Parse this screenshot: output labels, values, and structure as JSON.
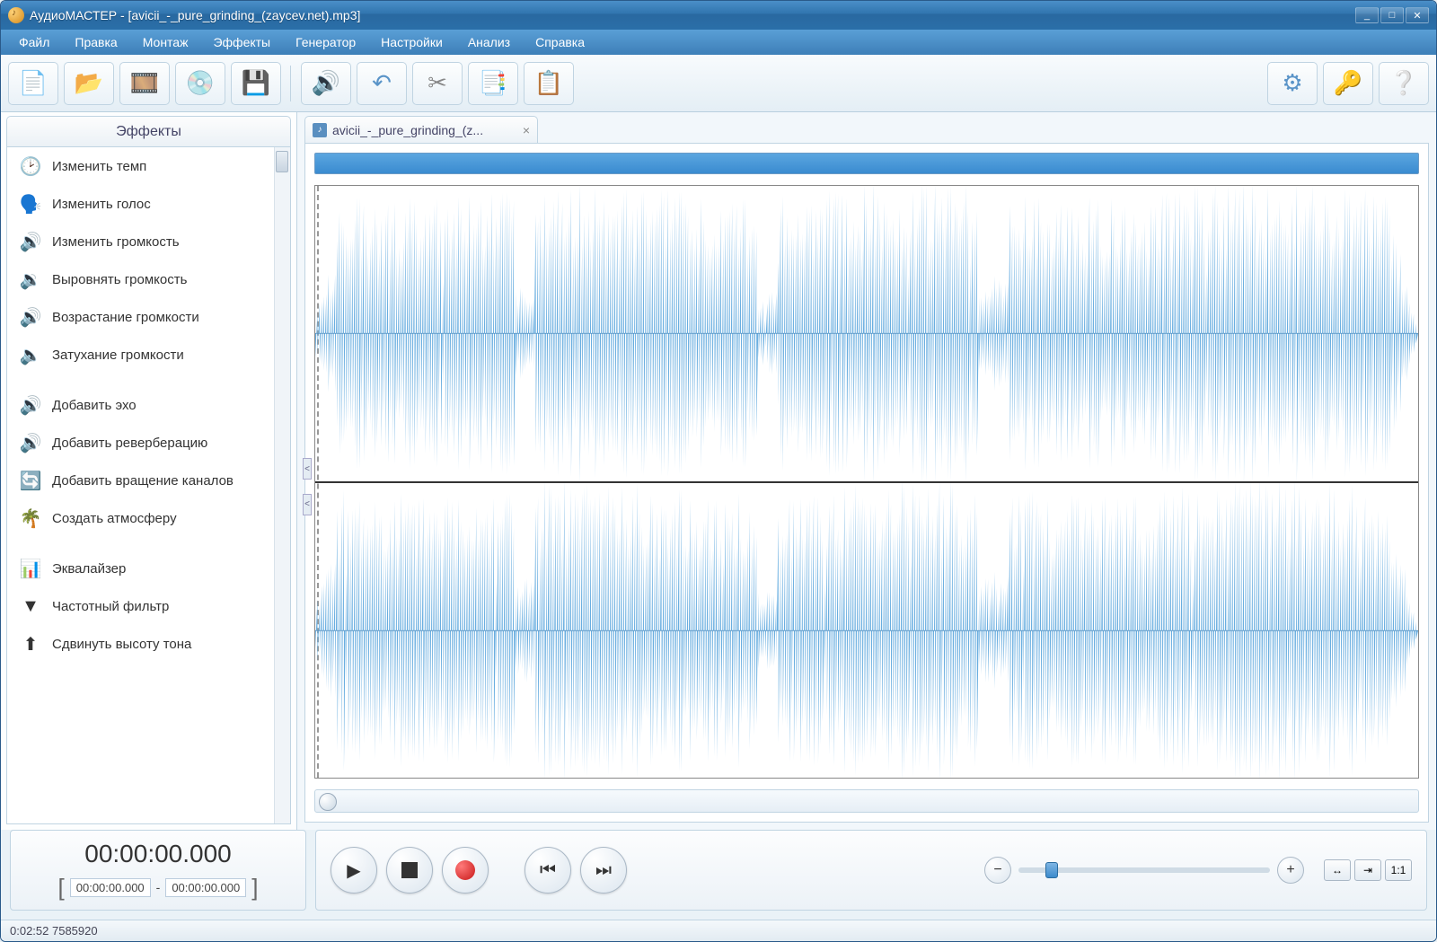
{
  "titlebar": {
    "title": "АудиоМАСТЕР - [avicii_-_pure_grinding_(zaycev.net).mp3]"
  },
  "menu": {
    "items": [
      "Файл",
      "Правка",
      "Монтаж",
      "Эффекты",
      "Генератор",
      "Настройки",
      "Анализ",
      "Справка"
    ]
  },
  "toolbar": {
    "new": "new-file-icon",
    "open": "open-folder-icon",
    "video": "import-video-icon",
    "cd": "import-cd-icon",
    "save": "save-icon",
    "process": "apply-effect-icon",
    "undo": "undo-icon",
    "cut": "cut-icon",
    "copy": "copy-icon",
    "paste": "paste-icon",
    "settings": "settings-icon",
    "key": "license-key-icon",
    "help": "help-icon"
  },
  "sidebar": {
    "header": "Эффекты",
    "groups": [
      [
        {
          "icon": "clock",
          "label": "Изменить темп"
        },
        {
          "icon": "voice",
          "label": "Изменить голос"
        },
        {
          "icon": "volume",
          "label": "Изменить громкость"
        },
        {
          "icon": "normalize",
          "label": "Выровнять громкость"
        },
        {
          "icon": "fadein",
          "label": "Возрастание громкости"
        },
        {
          "icon": "fadeout",
          "label": "Затухание громкости"
        }
      ],
      [
        {
          "icon": "echo",
          "label": "Добавить эхо"
        },
        {
          "icon": "reverb",
          "label": "Добавить реверберацию"
        },
        {
          "icon": "rotate",
          "label": "Добавить вращение каналов"
        },
        {
          "icon": "atmos",
          "label": "Создать атмосферу"
        }
      ],
      [
        {
          "icon": "eq",
          "label": "Эквалайзер"
        },
        {
          "icon": "filter",
          "label": "Частотный фильтр"
        },
        {
          "icon": "pitch",
          "label": "Сдвинуть высоту тона"
        }
      ]
    ]
  },
  "tab": {
    "label": "avicii_-_pure_grinding_(z..."
  },
  "time": {
    "current": "00:00:00.000",
    "sel_start": "00:00:00.000",
    "sel_end": "00:00:00.000",
    "separator": "-"
  },
  "fitbtns": {
    "fit_h": "↔",
    "fit_sel": "⇥",
    "ratio": "1:1"
  },
  "status": {
    "text": "0:02:52 7585920"
  },
  "icon_glyphs": {
    "clock": "🕑",
    "voice": "🗣️",
    "volume": "🔊",
    "normalize": "🔉",
    "fadein": "🔊",
    "fadeout": "🔈",
    "echo": "🔊",
    "reverb": "🔊",
    "rotate": "🔄",
    "atmos": "🌴",
    "eq": "📊",
    "filter": "▼",
    "pitch": "⬆"
  }
}
